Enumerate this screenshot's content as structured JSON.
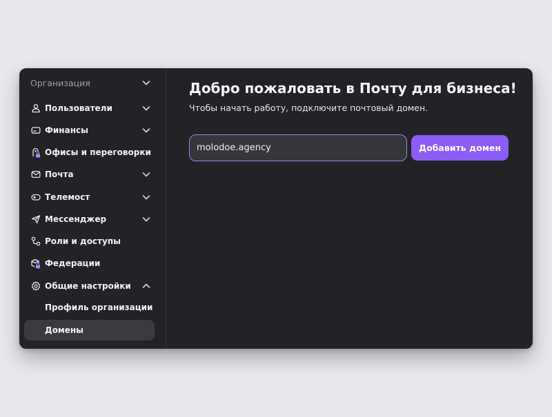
{
  "sidebar": {
    "org_label": "Организация",
    "items": [
      {
        "label": "Пользователи",
        "icon": "user-icon"
      },
      {
        "label": "Финансы",
        "icon": "wallet-icon"
      },
      {
        "label": "Офисы и переговорки",
        "icon": "office-lock-icon"
      },
      {
        "label": "Почта",
        "icon": "mail-icon"
      },
      {
        "label": "Телемост",
        "icon": "video-call-icon"
      },
      {
        "label": "Мессенджер",
        "icon": "paper-plane-icon"
      },
      {
        "label": "Роли и доступы",
        "icon": "roles-icon"
      },
      {
        "label": "Федерации",
        "icon": "federation-lock-icon"
      },
      {
        "label": "Общие настройки",
        "icon": "gear-icon"
      }
    ],
    "sub_items": [
      {
        "label": "Профиль организации"
      },
      {
        "label": "Домены",
        "active": true
      }
    ]
  },
  "main": {
    "title": "Добро пожаловать в Почту для бизнеса!",
    "subtitle": "Чтобы начать работу, подключите почтовый домен.",
    "domain_input_value": "molodoe.agency",
    "add_button_label": "Добавить домен"
  },
  "colors": {
    "accent": "#8b5cf6",
    "focus_border": "#9a84f0",
    "panel": "#232327",
    "active_item": "#3a3a40"
  }
}
